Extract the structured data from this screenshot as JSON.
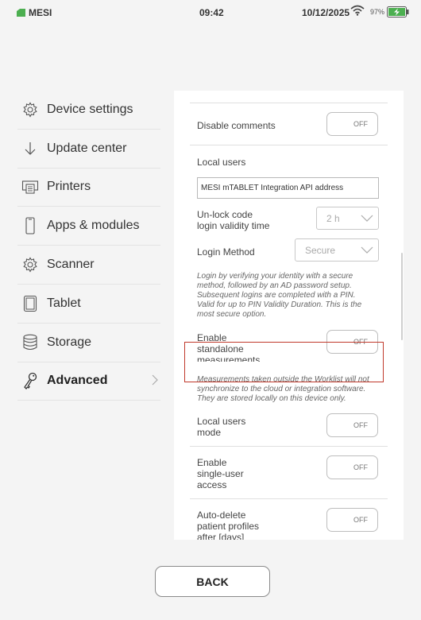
{
  "status_bar": {
    "app_name": "MESI",
    "time": "09:42",
    "date": "10/12/2025",
    "battery_percent": "97%",
    "brand_color": "#4caf50"
  },
  "sidebar": {
    "items": [
      {
        "label": "Device settings",
        "icon": "gear-icon"
      },
      {
        "label": "Update center",
        "icon": "arrow-down-icon"
      },
      {
        "label": "Printers",
        "icon": "printer-icon"
      },
      {
        "label": "Apps & modules",
        "icon": "phone-icon"
      },
      {
        "label": "Scanner",
        "icon": "gear-icon"
      },
      {
        "label": "Tablet",
        "icon": "tablet-icon"
      },
      {
        "label": "Storage",
        "icon": "database-icon"
      },
      {
        "label": "Advanced",
        "icon": "key-icon",
        "active": true
      }
    ]
  },
  "settings": {
    "disable_comments": {
      "label": "Disable comments",
      "value": "OFF"
    },
    "local_users": {
      "label": "Local users"
    },
    "api_address": {
      "value": "MESI mTABLET Integration API address"
    },
    "unlock_code": {
      "label_line1": "Un-lock code",
      "label_line2": "login validity time",
      "value": "2 h"
    },
    "login_method": {
      "label": "Login Method",
      "value": "Secure"
    },
    "login_note": [
      "Login by verifying your identity with a secure",
      "method, followed by an AD password setup.",
      "Subsequent logins are completed with a PIN.",
      "Valid for up to PIN Validity Duration. This is the",
      "most secure option."
    ],
    "standalone": {
      "label_line1": "Enable",
      "label_line2": "standalone",
      "label_line3": "measurements",
      "value": "OFF"
    },
    "standalone_note": [
      "Measurements taken outside the Worklist will not",
      "synchronize to the cloud or integration software.",
      "They are stored locally on this device only."
    ],
    "local_users_mode": {
      "label_line1": "Local users",
      "label_line2": "mode",
      "value": "OFF"
    },
    "single_user": {
      "label_line1": "Enable",
      "label_line2": "single-user",
      "label_line3": "access",
      "value": "OFF"
    },
    "auto_delete": {
      "label_line1": "Auto-delete",
      "label_line2": "patient profiles",
      "label_line3": "after [days]",
      "value": "OFF"
    }
  },
  "highlight_color": "#c0392b",
  "footer": {
    "back_label": "BACK"
  }
}
